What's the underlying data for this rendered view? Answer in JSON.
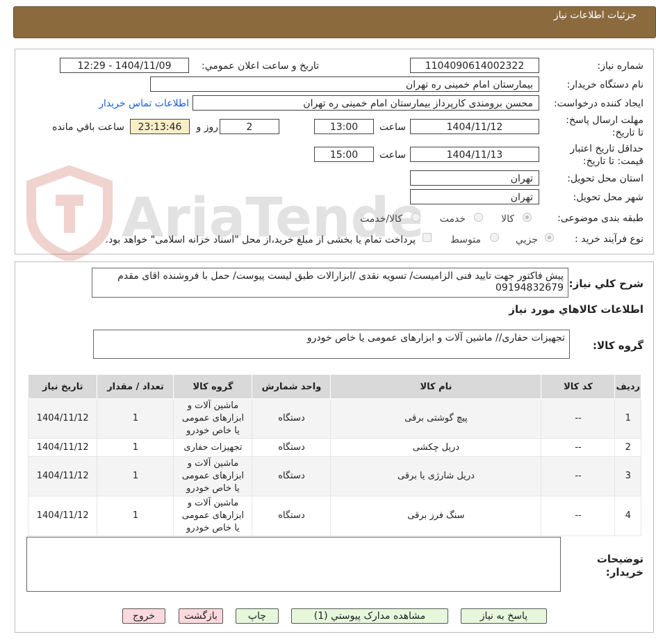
{
  "header": {
    "title": "جزئیات اطلاعات نیاز"
  },
  "form": {
    "need_number_label": "شماره نیاز:",
    "need_number": "1104090614002322",
    "announce_label": "تاریخ و ساعت اعلان عمومي:",
    "announce_value": "1404/11/09 - 12:29",
    "buyer_org_label": "نام دستگاه خريدار:",
    "buyer_org": "بیمارستان امام خمینی ره  تهران",
    "requester_label": "ایجاد کننده درخواست:",
    "requester": "محسن برومندی کارپرداز بیمارستان امام خمینی ره  تهران",
    "contact_link": "اطلاعات تماس خریدار",
    "deadline_label": "مهلت ارسال پاسخ: تا تاریخ:",
    "deadline_date": "1404/11/12",
    "time_word": "ساعت",
    "deadline_time": "13:00",
    "days": "2",
    "days_word": "روز و",
    "remaining": "23:13:46",
    "remaining_word": "ساعت باقي مانده",
    "validity_label": "حداقل تاریخ اعتبار قیمت: تا تاریخ:",
    "validity_date": "1404/11/13",
    "validity_time": "15:00",
    "province_label": "استان محل تحویل:",
    "province": "تهران",
    "city_label": "شهر محل تحویل:",
    "city": "تهران",
    "category_label": "طبقه بندی موضوعی:",
    "category_options": [
      "کالا",
      "خدمت",
      "کالا/خدمت"
    ],
    "process_label": "نوع فرآیند خرید :",
    "process_options": [
      "جزيي",
      "متوسط"
    ],
    "process_note": "پرداخت تمام یا بخشی از مبلغ خرید،از محل \"اسناد خزانه اسلامی\" خواهد بود."
  },
  "summary": {
    "label": "شرح كلي نياز:",
    "text": "پیش فاکتور جهت تایید فنی الزامیست/ تسویه نقدی /ابزارالات طبق لیست پیوست/ حمل با فروشنده اقای مقدم 09194832679"
  },
  "goods": {
    "section_title": "اطلاعات كالاهاي مورد نياز",
    "group_label": "گروه کالا:",
    "group_value": "تجهیزات حفاری//  ماشین آلات و ابزارهای عمومی یا خاص خودرو",
    "columns": [
      "رديف",
      "کد کالا",
      "نام کالا",
      "واحد شمارش",
      "گروه کالا",
      "تعداد / مقدار",
      "تاریخ نیاز"
    ],
    "rows": [
      {
        "idx": "1",
        "code": "--",
        "name": "پیچ گوشتی برقی",
        "unit": "دستگاه",
        "group": "ماشین آلات و ابزارهای عمومی یا خاص خودرو",
        "qty": "1",
        "date": "1404/11/12"
      },
      {
        "idx": "2",
        "code": "--",
        "name": "دریل چکشی",
        "unit": "دستگاه",
        "group": "تجهیزات حفاری",
        "qty": "1",
        "date": "1404/11/12"
      },
      {
        "idx": "3",
        "code": "--",
        "name": "دریل شارژی یا برقی",
        "unit": "دستگاه",
        "group": "ماشین آلات و ابزارهای عمومی یا خاص خودرو",
        "qty": "1",
        "date": "1404/11/12"
      },
      {
        "idx": "4",
        "code": "--",
        "name": "سنگ فرز برقی",
        "unit": "دستگاه",
        "group": "ماشین آلات و ابزارهای عمومی یا خاص خودرو",
        "qty": "1",
        "date": "1404/11/12"
      }
    ]
  },
  "notes": {
    "label": "توضیحات خریدار:",
    "value": ""
  },
  "buttons": {
    "reply": "پاسخ به نیاز",
    "attachments": "مشاهده مدارک پیوستي (1)",
    "print": "چاپ",
    "back": "بازگشت",
    "exit": "خروج"
  },
  "watermark": {
    "text": "AriaTender.neT"
  },
  "colors": {
    "header_bg": "#8b6a3e",
    "link": "#1a5bd4",
    "timer_bg": "#f9efc6",
    "green_btn": "#e6f7dc",
    "pink_btn": "#fbd9df"
  }
}
